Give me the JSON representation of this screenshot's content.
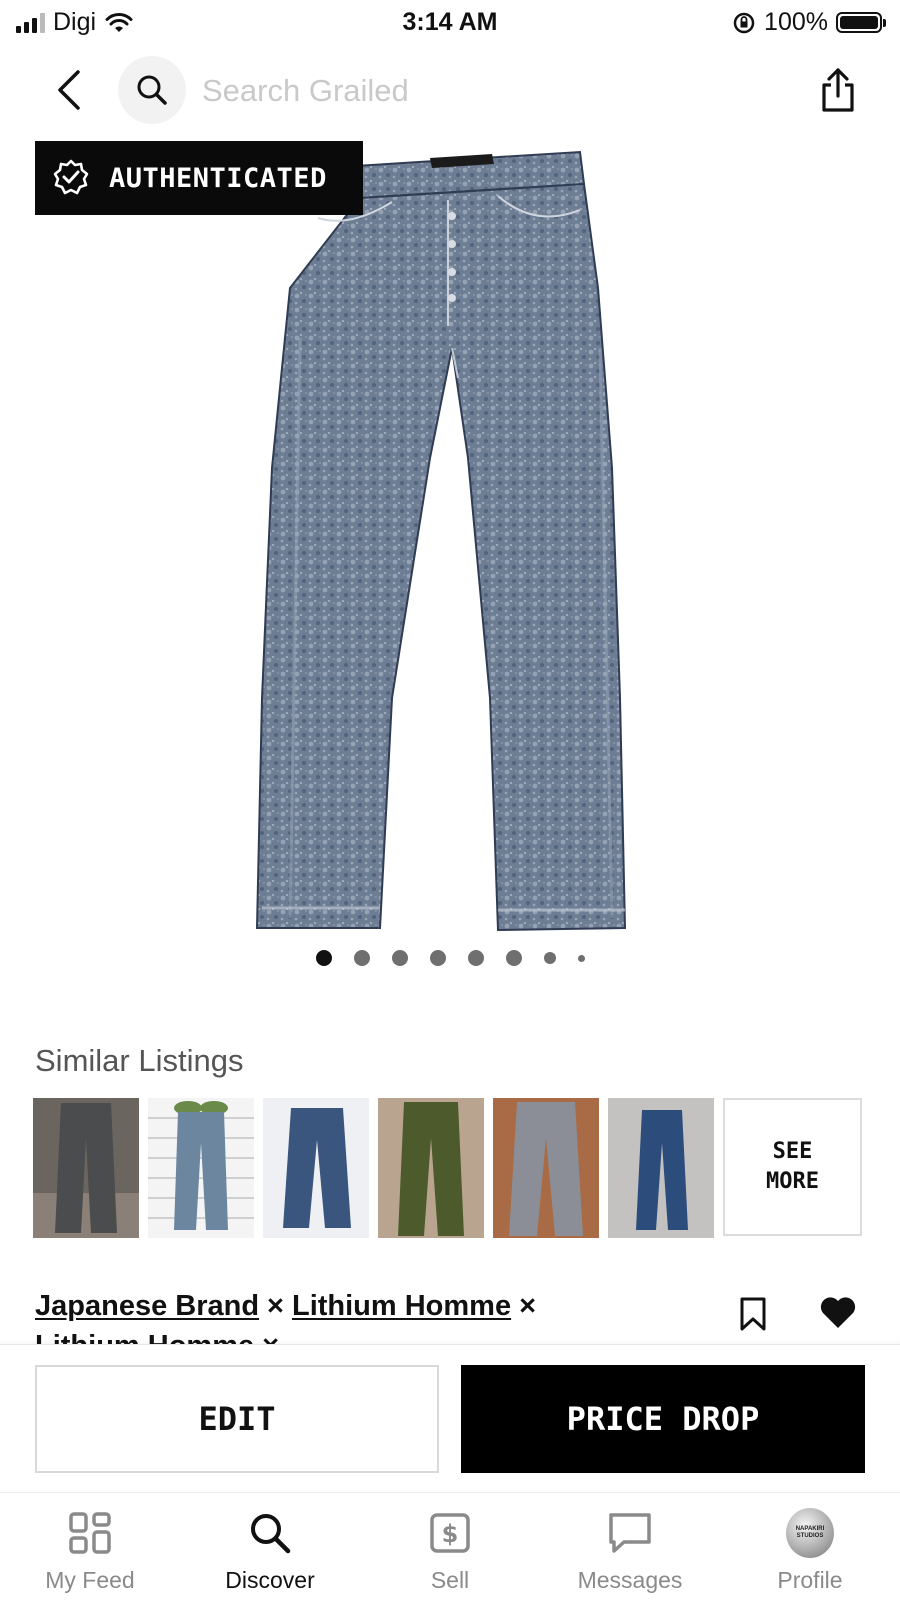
{
  "status_bar": {
    "carrier": "Digi",
    "time": "3:14 AM",
    "battery": "100%"
  },
  "search": {
    "placeholder": "Search Grailed",
    "value": ""
  },
  "product": {
    "badge": "AUTHENTICATED",
    "image_count": 8,
    "active_image_index": 0,
    "colors": {
      "denim": "#6f7f96",
      "badge_bg": "#0a0a0a"
    }
  },
  "similar": {
    "title": "Similar Listings",
    "see_more": "SEE\nMORE",
    "thumb_colors": [
      "#4a4c4e",
      "#6c86a0",
      "#3a567e",
      "#4d5a2c",
      "#8b8e96",
      "#2c4c7c"
    ]
  },
  "listing": {
    "designers": [
      "Japanese Brand",
      "Lithium Homme"
    ],
    "separator": "×",
    "designer_cut": "Lithium Homme ×"
  },
  "actions": {
    "edit": "EDIT",
    "price_drop": "PRICE DROP"
  },
  "tabs": [
    {
      "label": "My Feed",
      "icon": "grid-icon"
    },
    {
      "label": "Discover",
      "icon": "search-icon"
    },
    {
      "label": "Sell",
      "icon": "dollar-tag-icon"
    },
    {
      "label": "Messages",
      "icon": "chat-bubble-icon"
    },
    {
      "label": "Profile",
      "icon": "avatar",
      "avatar_text": "NAPAKIRI STUDIOS"
    }
  ]
}
